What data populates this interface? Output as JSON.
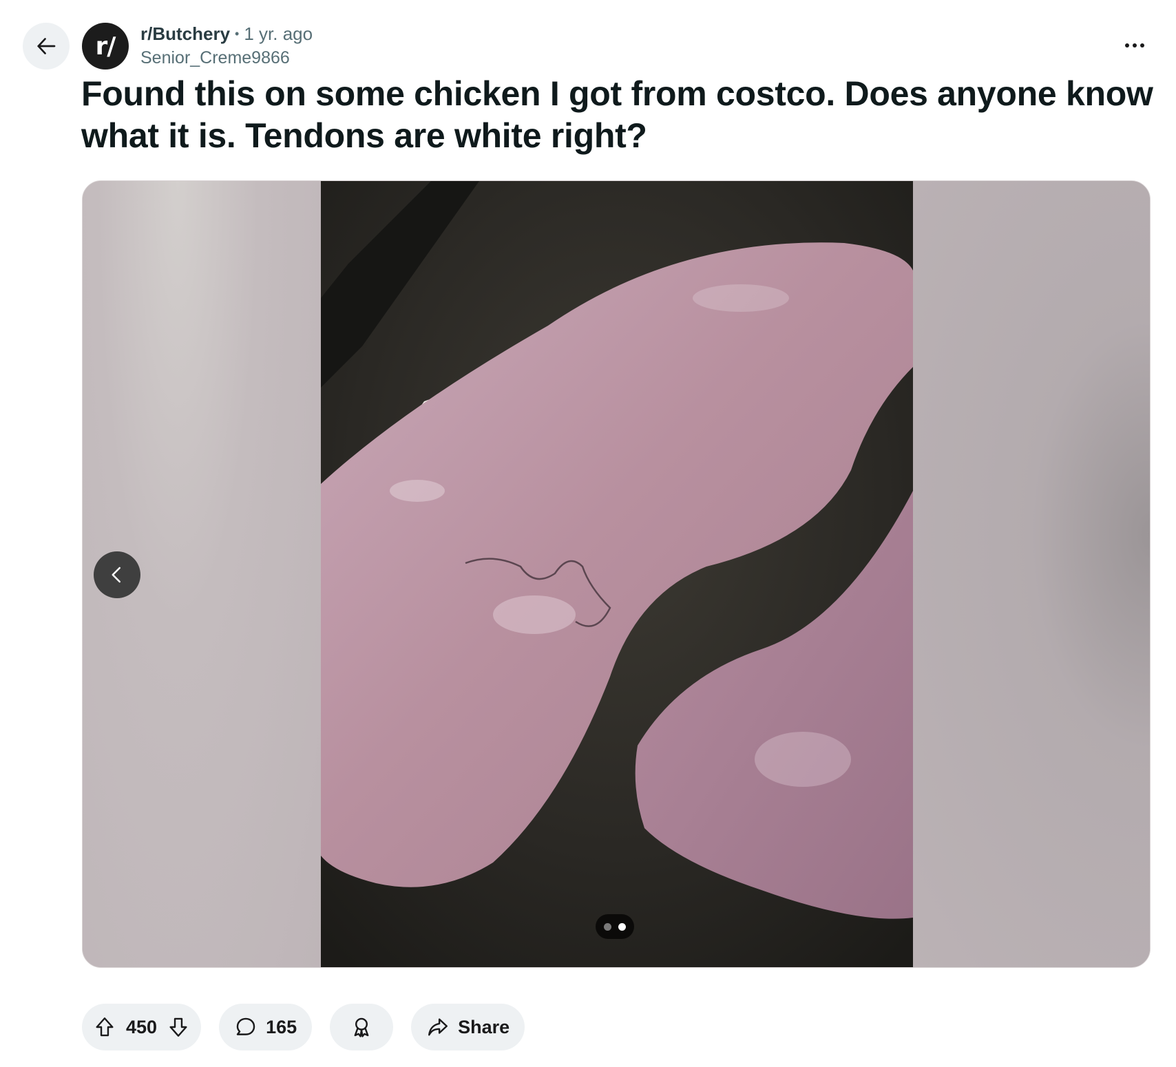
{
  "post": {
    "subreddit": "r/Butchery",
    "subreddit_avatar_text": "r/",
    "separator": "•",
    "age": "1 yr. ago",
    "author": "Senior_Creme9866",
    "title": "Found this on some chicken I got from costco. Does anyone know what it is. Tendons are white right?"
  },
  "gallery": {
    "total_images": 2,
    "current_image": 2
  },
  "actions": {
    "upvotes": "450",
    "comments": "165",
    "share_label": "Share"
  },
  "icons": {
    "back": "arrow-left-icon",
    "more": "more-horizontal-icon",
    "prev": "chevron-left-icon",
    "upvote": "upvote-arrow-icon",
    "downvote": "downvote-arrow-icon",
    "comment": "comment-bubble-icon",
    "award": "award-ribbon-icon",
    "share": "share-arrow-icon"
  }
}
